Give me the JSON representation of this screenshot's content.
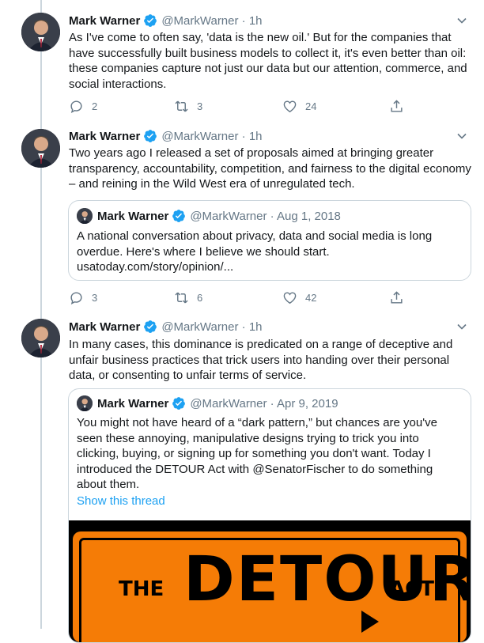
{
  "accent": "#1da1f2",
  "tweets": [
    {
      "name": "Mark Warner",
      "handle": "@MarkWarner · 1h",
      "text": "As I've come to often say, 'data is the new oil.' But for the companies that have successfully built business models to collect it, it's even better than oil: these companies capture not just our data but our attention, commerce, and social interactions.",
      "replies": "2",
      "retweets": "3",
      "likes": "24"
    },
    {
      "name": "Mark Warner",
      "handle": "@MarkWarner · 1h",
      "text": "Two years ago I released a set of proposals aimed at bringing greater transparency, accountability, competition, and fairness to the digital economy – and reining in the Wild West era of unregulated tech.",
      "quote": {
        "name": "Mark Warner",
        "handle": "@MarkWarner · Aug 1, 2018",
        "text": "A national conversation about privacy, data and social media is long overdue. Here's where I believe we should start.",
        "link": "usatoday.com/story/opinion/..."
      },
      "replies": "3",
      "retweets": "6",
      "likes": "42"
    },
    {
      "name": "Mark Warner",
      "handle": "@MarkWarner · 1h",
      "text": "In many cases, this dominance is predicated on a range of deceptive and unfair business practices that trick users into handing over their personal data, or consenting to unfair terms of service.",
      "quote": {
        "name": "Mark Warner",
        "handle": "@MarkWarner · Apr 9, 2019",
        "text": "You might not have heard of a “dark pattern,” but chances are you've seen these annoying, manipulative designs trying to trick you into clicking, buying, or signing up for something you don't want. Today I introduced the DETOUR Act with @SenatorFischer to do something about them.",
        "show_thread": "Show this thread",
        "image": {
          "the": "THE",
          "detour": "DETOUR",
          "act": "ACT"
        }
      }
    }
  ]
}
